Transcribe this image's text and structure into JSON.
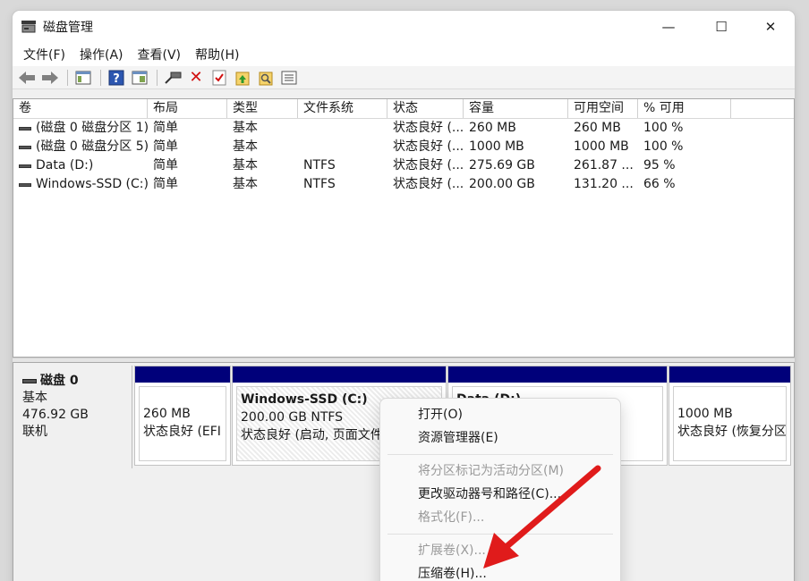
{
  "window": {
    "title": "磁盘管理",
    "minimize": "—",
    "maximize": "☐",
    "close": "✕"
  },
  "menu": [
    "文件(F)",
    "操作(A)",
    "查看(V)",
    "帮助(H)"
  ],
  "toolbar": {
    "icons": [
      "back-arrow-icon",
      "forward-arrow-icon",
      "console-tree-icon",
      "help-icon",
      "properties-icon",
      "connect-icon",
      "delete-icon",
      "check-icon",
      "up-folder-icon",
      "search-folder-icon",
      "list-icon"
    ],
    "delete_glyph": "✕",
    "help_glyph": "?"
  },
  "volumes": {
    "columns": [
      "卷",
      "布局",
      "类型",
      "文件系统",
      "状态",
      "容量",
      "可用空间",
      "% 可用"
    ],
    "rows": [
      [
        "(磁盘 0 磁盘分区 1)",
        "简单",
        "基本",
        "",
        "状态良好 (...",
        "260 MB",
        "260 MB",
        "100 %"
      ],
      [
        "(磁盘 0 磁盘分区 5)",
        "简单",
        "基本",
        "",
        "状态良好 (...",
        "1000 MB",
        "1000 MB",
        "100 %"
      ],
      [
        "Data (D:)",
        "简单",
        "基本",
        "NTFS",
        "状态良好 (...",
        "275.69 GB",
        "261.87 ...",
        "95 %"
      ],
      [
        "Windows-SSD (C:)",
        "简单",
        "基本",
        "NTFS",
        "状态良好 (...",
        "200.00 GB",
        "131.20 ...",
        "66 %"
      ]
    ]
  },
  "disk": {
    "name": "磁盘 0",
    "type": "基本",
    "size": "476.92 GB",
    "status": "联机",
    "partitions": [
      {
        "line1": "",
        "line2": "260 MB",
        "line3": "状态良好 (EFI 系"
      },
      {
        "line1": "Windows-SSD  (C:)",
        "line2": "200.00 GB NTFS",
        "line3": "状态良好 (启动, 页面文件"
      },
      {
        "line1": "Data (D:)",
        "line2": "",
        "line3": ""
      },
      {
        "line1": "",
        "line2": "1000 MB",
        "line3": "状态良好 (恢复分区"
      }
    ]
  },
  "context_menu": {
    "open": "打开(O)",
    "explorer": "资源管理器(E)",
    "mark_active": "将分区标记为活动分区(M)",
    "change_letter": "更改驱动器号和路径(C)...",
    "format": "格式化(F)...",
    "extend": "扩展卷(X)...",
    "shrink": "压缩卷(H)..."
  },
  "colors": {
    "partition_bar": "#00007a",
    "arrow": "#e01b1b"
  }
}
